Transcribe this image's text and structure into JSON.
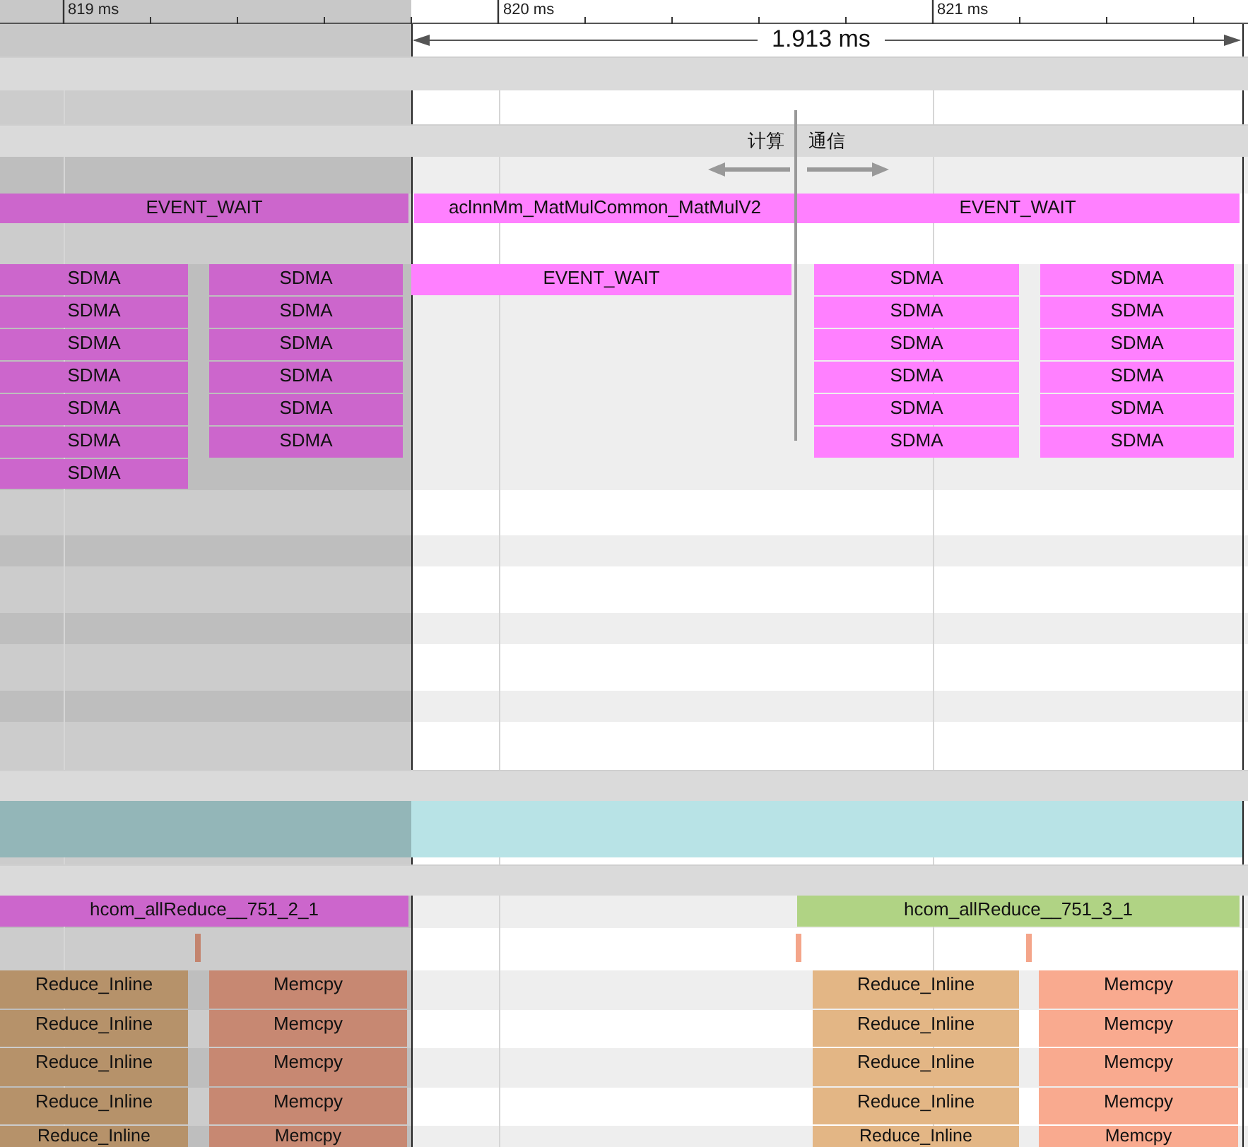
{
  "ruler": {
    "ticks": [
      "819 ms",
      "820 ms",
      "821 ms"
    ]
  },
  "selection": {
    "duration": "1.913 ms"
  },
  "annotation": {
    "left_label": "计算",
    "right_label": "通信"
  },
  "tracks": [
    {
      "kind": "header"
    },
    {
      "kind": "empty"
    },
    {
      "kind": "header"
    },
    {
      "kind": "empty"
    },
    {
      "kind": "slices",
      "slices": [
        {
          "label": "EVENT_WAIT",
          "color": "#cc66cc"
        },
        {
          "label": "aclnnMm_MatMulCommon_MatMulV2",
          "color": "#ff80ff"
        },
        {
          "label": "EVENT_WAIT",
          "color": "#ff80ff"
        }
      ]
    },
    {
      "kind": "empty"
    },
    {
      "kind": "slices",
      "slices": [
        {
          "label": "SDMA",
          "color": "#cc66cc"
        },
        {
          "label": "SDMA",
          "color": "#cc66cc"
        },
        {
          "label": "EVENT_WAIT",
          "color": "#ff80ff"
        },
        {
          "label": "SDMA",
          "color": "#ff80ff"
        },
        {
          "label": "SDMA",
          "color": "#ff80ff"
        }
      ]
    },
    {
      "kind": "slices",
      "slices": [
        {
          "label": "SDMA",
          "color": "#cc66cc"
        },
        {
          "label": "SDMA",
          "color": "#cc66cc"
        },
        {
          "label": "SDMA",
          "color": "#ff80ff"
        },
        {
          "label": "SDMA",
          "color": "#ff80ff"
        }
      ]
    },
    {
      "kind": "slices",
      "slices": [
        {
          "label": "SDMA",
          "color": "#cc66cc"
        },
        {
          "label": "SDMA",
          "color": "#cc66cc"
        },
        {
          "label": "SDMA",
          "color": "#ff80ff"
        },
        {
          "label": "SDMA",
          "color": "#ff80ff"
        }
      ]
    },
    {
      "kind": "slices",
      "slices": [
        {
          "label": "SDMA",
          "color": "#cc66cc"
        },
        {
          "label": "SDMA",
          "color": "#cc66cc"
        },
        {
          "label": "SDMA",
          "color": "#ff80ff"
        },
        {
          "label": "SDMA",
          "color": "#ff80ff"
        }
      ]
    },
    {
      "kind": "slices",
      "slices": [
        {
          "label": "SDMA",
          "color": "#cc66cc"
        },
        {
          "label": "SDMA",
          "color": "#cc66cc"
        },
        {
          "label": "SDMA",
          "color": "#ff80ff"
        },
        {
          "label": "SDMA",
          "color": "#ff80ff"
        }
      ]
    },
    {
      "kind": "slices",
      "slices": [
        {
          "label": "SDMA",
          "color": "#cc66cc"
        },
        {
          "label": "SDMA",
          "color": "#cc66cc"
        },
        {
          "label": "SDMA",
          "color": "#ff80ff"
        },
        {
          "label": "SDMA",
          "color": "#ff80ff"
        }
      ]
    },
    {
      "kind": "slices",
      "slices": [
        {
          "label": "SDMA",
          "color": "#cc66cc"
        }
      ]
    },
    {
      "kind": "empty"
    },
    {
      "kind": "empty"
    },
    {
      "kind": "empty"
    },
    {
      "kind": "empty"
    },
    {
      "kind": "empty"
    },
    {
      "kind": "empty"
    },
    {
      "kind": "empty"
    },
    {
      "kind": "header"
    },
    {
      "kind": "band",
      "color": "#b8e3e6"
    },
    {
      "kind": "header"
    },
    {
      "kind": "slices",
      "slices": [
        {
          "label": "hcom_allReduce__751_2_1",
          "color": "#cc66cc"
        },
        {
          "label": "hcom_allReduce__751_3_1",
          "color": "#b0d384"
        }
      ]
    },
    {
      "kind": "slices",
      "slices": [
        {
          "color": "#c3846e"
        },
        {
          "color": "#f4a58a"
        },
        {
          "color": "#f4a58a"
        }
      ]
    },
    {
      "kind": "slices",
      "slices": [
        {
          "label": "Reduce_Inline",
          "color": "#b6926a"
        },
        {
          "label": "Memcpy",
          "color": "#c78872"
        },
        {
          "label": "Reduce_Inline",
          "color": "#e3b685"
        },
        {
          "label": "Memcpy",
          "color": "#f9aa8f"
        }
      ]
    },
    {
      "kind": "slices",
      "slices": [
        {
          "label": "Reduce_Inline",
          "color": "#b6926a"
        },
        {
          "label": "Memcpy",
          "color": "#c78872"
        },
        {
          "label": "Reduce_Inline",
          "color": "#e3b685"
        },
        {
          "label": "Memcpy",
          "color": "#f9aa8f"
        }
      ]
    },
    {
      "kind": "slices",
      "slices": [
        {
          "label": "Reduce_Inline",
          "color": "#b6926a"
        },
        {
          "label": "Memcpy",
          "color": "#c78872"
        },
        {
          "label": "Reduce_Inline",
          "color": "#e3b685"
        },
        {
          "label": "Memcpy",
          "color": "#f9aa8f"
        }
      ]
    },
    {
      "kind": "slices",
      "slices": [
        {
          "label": "Reduce_Inline",
          "color": "#b6926a"
        },
        {
          "label": "Memcpy",
          "color": "#c78872"
        },
        {
          "label": "Reduce_Inline",
          "color": "#e3b685"
        },
        {
          "label": "Memcpy",
          "color": "#f9aa8f"
        }
      ]
    },
    {
      "kind": "slices",
      "slices": [
        {
          "label": "Reduce_Inline",
          "color": "#b6926a"
        },
        {
          "label": "Memcpy",
          "color": "#c78872"
        },
        {
          "label": "Reduce_Inline",
          "color": "#e3b685"
        },
        {
          "label": "Memcpy",
          "color": "#f9aa8f"
        }
      ]
    }
  ]
}
